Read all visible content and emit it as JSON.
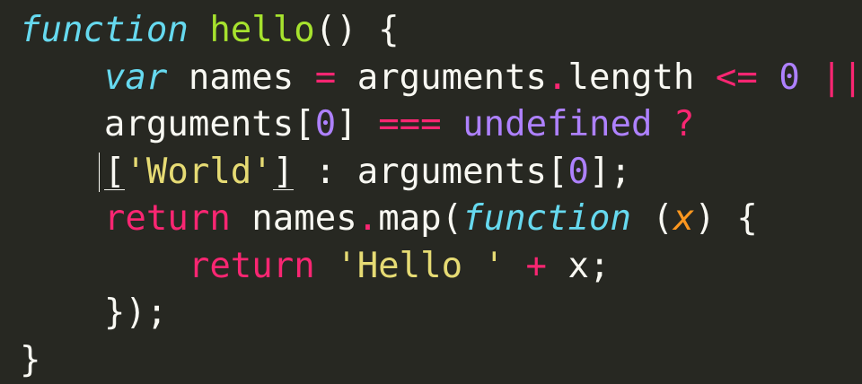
{
  "lines": [
    [
      {
        "t": "function",
        "c": "kw-storage"
      },
      {
        "t": " ",
        "c": "punct"
      },
      {
        "t": "hello",
        "c": "fn-name"
      },
      {
        "t": "() {",
        "c": "punct"
      }
    ],
    [
      {
        "t": "    ",
        "c": "punct"
      },
      {
        "t": "var",
        "c": "kw-storage"
      },
      {
        "t": " names ",
        "c": "ident"
      },
      {
        "t": "=",
        "c": "op"
      },
      {
        "t": " arguments",
        "c": "ident"
      },
      {
        "t": ".",
        "c": "op"
      },
      {
        "t": "length ",
        "c": "ident"
      },
      {
        "t": "<=",
        "c": "op"
      },
      {
        "t": " ",
        "c": "punct"
      },
      {
        "t": "0",
        "c": "num"
      },
      {
        "t": " ",
        "c": "punct"
      },
      {
        "t": "||",
        "c": "op"
      }
    ],
    [
      {
        "t": "    ",
        "c": "punct"
      },
      {
        "t": "arguments[",
        "c": "ident"
      },
      {
        "t": "0",
        "c": "num"
      },
      {
        "t": "] ",
        "c": "ident"
      },
      {
        "t": "===",
        "c": "op"
      },
      {
        "t": " ",
        "c": "punct"
      },
      {
        "t": "undefined",
        "c": "const"
      },
      {
        "t": " ",
        "c": "punct"
      },
      {
        "t": "?",
        "c": "op"
      }
    ],
    [
      {
        "t": "    ",
        "c": "punct"
      },
      {
        "t": "[",
        "c": "punct bracket-match"
      },
      {
        "t": "'World'",
        "c": "str"
      },
      {
        "t": "]",
        "c": "punct bracket-match"
      },
      {
        "t": " : arguments[",
        "c": "ident"
      },
      {
        "t": "0",
        "c": "num"
      },
      {
        "t": "];",
        "c": "ident"
      }
    ],
    [
      {
        "t": "    ",
        "c": "punct"
      },
      {
        "t": "return",
        "c": "kw-ctrl"
      },
      {
        "t": " names",
        "c": "ident"
      },
      {
        "t": ".",
        "c": "op"
      },
      {
        "t": "map(",
        "c": "ident"
      },
      {
        "t": "function",
        "c": "kw-storage"
      },
      {
        "t": " (",
        "c": "punct"
      },
      {
        "t": "x",
        "c": "param"
      },
      {
        "t": ") {",
        "c": "punct"
      }
    ],
    [
      {
        "t": "        ",
        "c": "punct"
      },
      {
        "t": "return",
        "c": "kw-ctrl"
      },
      {
        "t": " ",
        "c": "punct"
      },
      {
        "t": "'Hello '",
        "c": "str"
      },
      {
        "t": " ",
        "c": "punct"
      },
      {
        "t": "+",
        "c": "op"
      },
      {
        "t": " x;",
        "c": "ident"
      }
    ],
    [
      {
        "t": "    ",
        "c": "punct"
      },
      {
        "t": "});",
        "c": "punct"
      }
    ],
    [
      {
        "t": "}",
        "c": "punct"
      }
    ]
  ],
  "colors": {
    "background": "#272822",
    "foreground": "#f8f8f2",
    "keyword_storage": "#66d9ef",
    "keyword_control": "#f92672",
    "function_name": "#a6e22e",
    "number": "#ae81ff",
    "string": "#e6db74",
    "parameter": "#fd971f"
  }
}
